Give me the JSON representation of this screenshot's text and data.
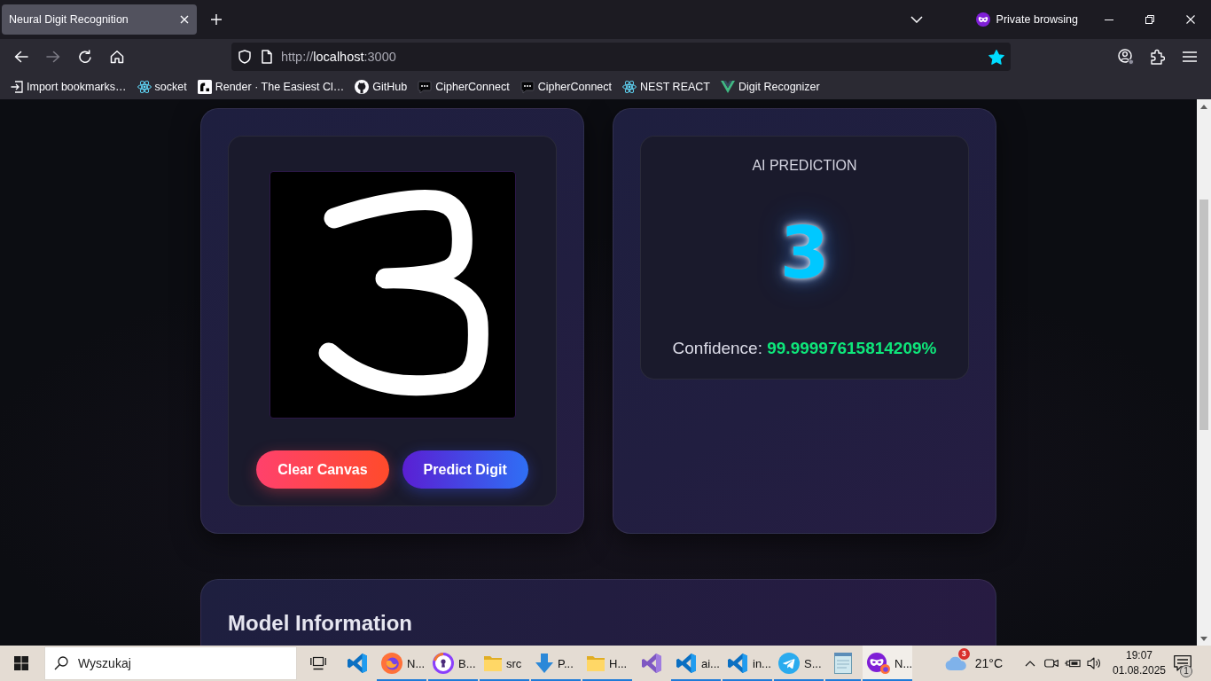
{
  "browser": {
    "tabs": [
      {
        "title": "Neural Digit Recognition",
        "selected": true
      }
    ],
    "private_browsing": {
      "label": "Private browsing"
    },
    "nav_buttons": [
      {
        "kind": "back",
        "disabled": false
      },
      {
        "kind": "forward",
        "disabled": true
      },
      {
        "kind": "reload",
        "disabled": false
      },
      {
        "kind": "home",
        "disabled": false
      }
    ],
    "address": {
      "scheme": "http://",
      "host": "localhost",
      "port": ":3000",
      "bookmarked": true
    },
    "bookmarks": [
      {
        "kind": "import",
        "label": "Import bookmarks…"
      },
      {
        "kind": "react",
        "label": "socket"
      },
      {
        "kind": "render",
        "label": "Render · The Easiest Cl…"
      },
      {
        "kind": "github",
        "label": "GitHub"
      },
      {
        "kind": "chat",
        "label": "CipherConnect"
      },
      {
        "kind": "chat",
        "label": "CipherConnect"
      },
      {
        "kind": "react",
        "label": "NEST REACT"
      },
      {
        "kind": "vue",
        "label": "Digit Recognizer"
      }
    ]
  },
  "drawing_panel": {
    "buttons": [
      {
        "kind": "clear",
        "label": "Clear Canvas"
      },
      {
        "kind": "predict",
        "label": "Predict Digit"
      }
    ]
  },
  "prediction_panel": {
    "heading": "AI PREDICTION",
    "digit": "3",
    "confidence": "Confidence: **99.99997615814209%**"
  },
  "model_info": {
    "title": "Model Information"
  },
  "taskbar": {
    "search": {
      "placeholder": "Wyszukaj"
    },
    "apps": [
      {
        "kind": "vscode",
        "running": false,
        "selected": false
      },
      {
        "kind": "firefox",
        "label": "N...",
        "running": true,
        "selected": false
      },
      {
        "kind": "shield",
        "label": "B...",
        "running": true,
        "selected": false
      },
      {
        "kind": "folder",
        "label": "src",
        "running": true,
        "selected": false
      },
      {
        "kind": "download",
        "label": "P...",
        "running": true,
        "selected": false
      },
      {
        "kind": "folder",
        "label": "H...",
        "running": true,
        "selected": false
      },
      {
        "kind": "visualstudio",
        "running": false,
        "selected": false
      },
      {
        "kind": "vscode",
        "label": "ai...",
        "running": true,
        "selected": false
      },
      {
        "kind": "vscode",
        "label": "in...",
        "running": true,
        "selected": false
      },
      {
        "kind": "telegram",
        "label": "S...",
        "running": true,
        "selected": false
      },
      {
        "kind": "notepad",
        "running": true,
        "selected": false
      },
      {
        "kind": "private_browser",
        "label": "N...",
        "running": true,
        "selected": true
      }
    ],
    "weather": {
      "badge": "3",
      "temperature": "21°C"
    },
    "clock": {
      "time": "19:07",
      "date": "01.08.2025"
    },
    "notifications": {
      "badge": "1"
    }
  }
}
